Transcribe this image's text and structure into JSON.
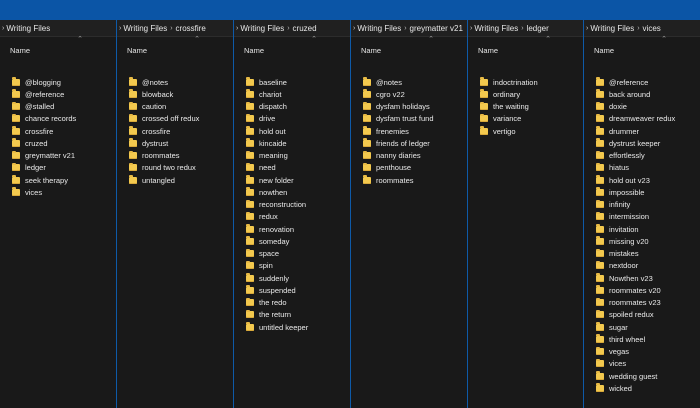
{
  "breadcrumb_root": "Writing Files",
  "columns": [
    {
      "crumb": "",
      "header": "Name",
      "items": [
        "@blogging",
        "@reference",
        "@stalled",
        "chance records",
        "crossfire",
        "cruzed",
        "greymatter v21",
        "ledger",
        "seek therapy",
        "vices"
      ]
    },
    {
      "crumb": "crossfire",
      "header": "Name",
      "items": [
        "@notes",
        "blowback",
        "caution",
        "crossed off redux",
        "crossfire",
        "dystrust",
        "roommates",
        "round two redux",
        "untangled"
      ]
    },
    {
      "crumb": "cruzed",
      "header": "Name",
      "items": [
        "baseline",
        "chariot",
        "dispatch",
        "drive",
        "hold out",
        "kincaide",
        "meaning",
        "need",
        "new folder",
        "nowthen",
        "reconstruction",
        "redux",
        "renovation",
        "someday",
        "space",
        "spin",
        "suddenly",
        "suspended",
        "the redo",
        "the return",
        "untitled keeper"
      ]
    },
    {
      "crumb": "greymatter v21",
      "header": "Name",
      "items": [
        "@notes",
        "cgro v22",
        "dysfam holidays",
        "dysfam trust fund",
        "frenemies",
        "friends of ledger",
        "nanny diaries",
        "penthouse",
        "roommates"
      ]
    },
    {
      "crumb": "ledger",
      "header": "Name",
      "items": [
        "indoctrination",
        "ordinary",
        "the waiting",
        "variance",
        "vertigo"
      ]
    },
    {
      "crumb": "vices",
      "header": "Name",
      "items": [
        "@reference",
        "back around",
        "doxie",
        "dreamweaver redux",
        "drummer",
        "dystrust keeper",
        "effortlessly",
        "hiatus",
        "hold out v23",
        "impossible",
        "infinity",
        "intermission",
        "invitation",
        "missing v20",
        "mistakes",
        "nextdoor",
        "Nowthen v23",
        "roommates v20",
        "roommates v23",
        "spoiled redux",
        "sugar",
        "third wheel",
        "vegas",
        "vices",
        "wedding guest",
        "wicked"
      ]
    }
  ]
}
